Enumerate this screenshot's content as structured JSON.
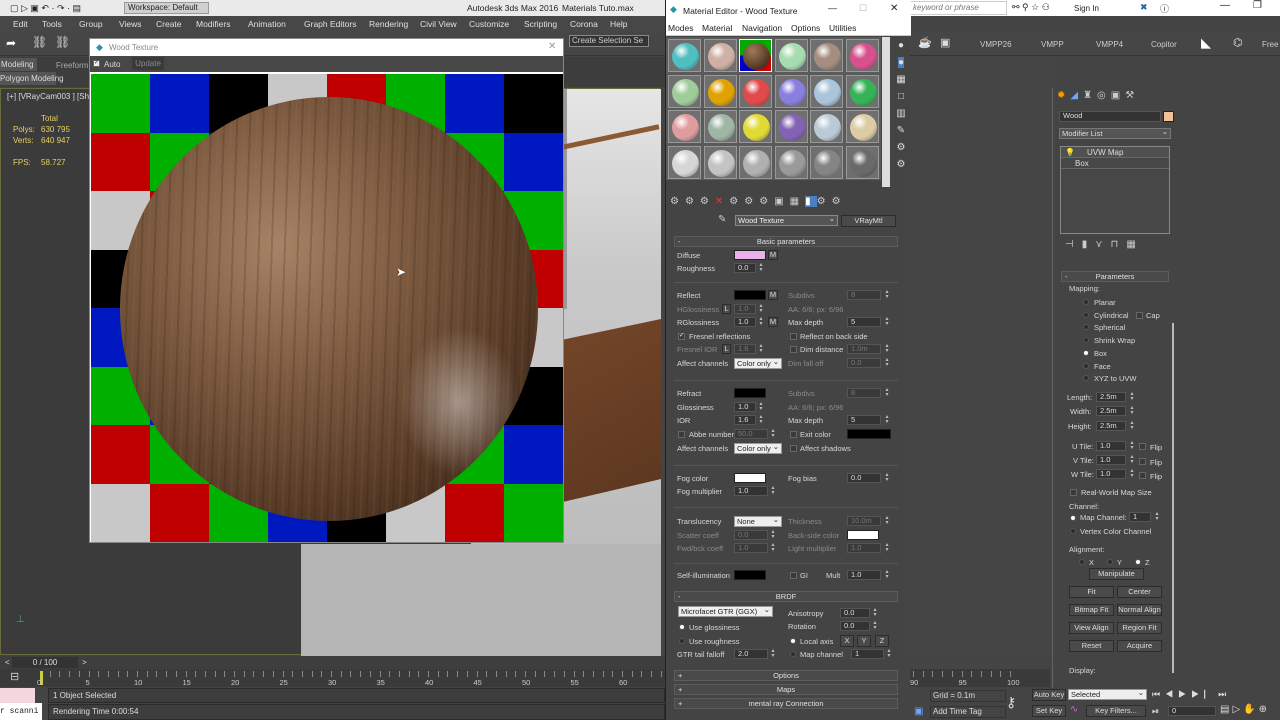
{
  "app": {
    "title": "Autodesk 3ds Max 2016",
    "file": "Materials Tuto.max",
    "workspace": "Workspace: Default",
    "search_placeholder": "keyword or phrase",
    "sign_in": "Sign In"
  },
  "menu": [
    "Edit",
    "Tools",
    "Group",
    "Views",
    "Create",
    "Modifiers",
    "Animation",
    "Graph Editors",
    "Rendering",
    "Civil View",
    "Customize",
    "Scripting",
    "Corona",
    "Help"
  ],
  "toolbar": {
    "selection_set": "Create Selection Se",
    "custom_buttons": [
      "VMPP26",
      "VMPP",
      "VMPP4",
      "Copitor"
    ],
    "free": "Free"
  },
  "ribbon": {
    "tabs": [
      "Modeling",
      "Freeform"
    ],
    "subtab": "Polygon Modeling"
  },
  "viewport": {
    "label": "[+] [VRayCam003 ] [Sh",
    "total": "Total",
    "polys_label": "Polys:",
    "polys": "630 795",
    "verts_label": "Verts:",
    "verts": "640 947",
    "fps_label": "FPS:",
    "fps": "58.727"
  },
  "render_window": {
    "title": "Wood Texture",
    "auto": "Auto",
    "update": "Update"
  },
  "mat_editor": {
    "title": "Material Editor - Wood Texture",
    "menu": [
      "Modes",
      "Material",
      "Navigation",
      "Options",
      "Utilities"
    ],
    "slot_colors": [
      "#4fbfc0",
      "#cfb0a4",
      "wood",
      "#a6dcb0",
      "#a58e80",
      "#d8508e",
      "#a0cc9c",
      "#e0a200",
      "#e04a4a",
      "#8a7ede",
      "#aac4dc",
      "#35b356",
      "#e09da0",
      "#9fb6a6",
      "#e2da34",
      "#8462b4",
      "#bccad8",
      "#dccca4",
      "#d6d6d6",
      "#c4c4c4",
      "#b0b0b0",
      "#9a9a9a",
      "#858585",
      "#6a6a6a"
    ],
    "material_name": "Wood Texture",
    "material_type": "VRayMtl",
    "basic": {
      "title": "Basic parameters",
      "minus": "-",
      "diffuse": "Diffuse",
      "diffuse_color": "#e8b2e8",
      "m": "M",
      "roughness": "Roughness",
      "roughness_val": "0.0",
      "reflect": "Reflect",
      "subdivs": "Subdivs",
      "subdivs_val": "8",
      "hgloss": "HGlossiness",
      "l": "L",
      "hgloss_val": "1.0",
      "aa": "AA: 6/6; px: 6/96",
      "rgloss": "RGlossiness",
      "rgloss_val": "1.0",
      "max_depth": "Max depth",
      "max_depth_val": "5",
      "fresnel": "Fresnel reflections",
      "back_side": "Reflect on back side",
      "fresnel_ior": "Fresnel IOR",
      "fresnel_ior_val": "1.6",
      "dim_distance": "Dim distance",
      "dim_distance_val": "1.0m",
      "affect": "Affect channels",
      "affect_val": "Color only",
      "dim_falloff": "Dim fall off",
      "dim_falloff_val": "0.0",
      "refract": "Refract",
      "r_subdivs_val": "8",
      "glossiness": "Glossiness",
      "glossiness_val": "1.0",
      "r_aa": "AA: 6/6; px: 6/96",
      "ior": "IOR",
      "ior_val": "1.6",
      "r_max_depth_val": "5",
      "abbe": "Abbe number",
      "abbe_val": "50.0",
      "exit_color": "Exit color",
      "r_affect_val": "Color only",
      "affect_shadows": "Affect shadows",
      "fog_color": "Fog color",
      "fog_bias": "Fog bias",
      "fog_bias_val": "0.0",
      "fog_mult": "Fog multiplier",
      "fog_mult_val": "1.0",
      "translucency": "Translucency",
      "translucency_val": "None",
      "thickness": "Thickness",
      "thickness_val": "10.0m",
      "scatter": "Scatter coeff",
      "scatter_val": "0.0",
      "backside_color": "Back-side color",
      "fwd": "Fwd/bck coeff",
      "fwd_val": "1.0",
      "light_mult": "Light multiplier",
      "light_mult_val": "1.0",
      "self_illum": "Self-illumination",
      "gi": "GI",
      "mult": "Mult",
      "mult_val": "1.0"
    },
    "brdf": {
      "title": "BRDF",
      "type": "Microfacet GTR (GGX)",
      "anisotropy": "Anisotropy",
      "anisotropy_val": "0.0",
      "rotation": "Rotation",
      "rotation_val": "0.0",
      "use_gloss": "Use glossiness",
      "use_rough": "Use roughness",
      "local_axis": "Local axis",
      "x": "X",
      "y": "Y",
      "z": "Z",
      "gtr": "GTR tail falloff",
      "gtr_val": "2.0",
      "map_channel": "Map channel",
      "map_channel_val": "1"
    },
    "rollouts": [
      "Options",
      "Maps",
      "mental ray Connection"
    ],
    "plus": "+"
  },
  "command_panel": {
    "object_name": "Wood",
    "object_color": "#f0c298",
    "modifier_list": "Modifier List",
    "stack": [
      "UVW Map",
      "Box"
    ],
    "params_title": "Parameters",
    "minus": "-",
    "mapping_label": "Mapping:",
    "mapping_options": [
      "Planar",
      "Cylindrical",
      "Spherical",
      "Shrink Wrap",
      "Box",
      "Face",
      "XYZ to UVW"
    ],
    "mapping_selected": "Box",
    "cap": "Cap",
    "length": "Length:",
    "length_val": "2.5m",
    "width": "Width:",
    "width_val": "2.5m",
    "height": "Height:",
    "height_val": "2.5m",
    "u_tile": "U Tile:",
    "v_tile": "V Tile:",
    "w_tile": "W Tile:",
    "u_val": "1.0",
    "v_val": "1.0",
    "w_val": "1.0",
    "flip": "Flip",
    "real_world": "Real-World Map Size",
    "channel_label": "Channel:",
    "map_channel": "Map Channel:",
    "map_channel_val": "1",
    "vertex_color": "Vertex Color Channel",
    "alignment_label": "Alignment:",
    "axes": [
      "X",
      "Y",
      "Z"
    ],
    "axis_selected": "Z",
    "manipulate": "Manipulate",
    "buttons": [
      "Fit",
      "Center",
      "Bitmap Fit",
      "Normal Align",
      "View Align",
      "Region Fit",
      "Reset",
      "Acquire"
    ],
    "display_label": "Display:"
  },
  "timeline": {
    "frame": "0 / 100",
    "prev": "<",
    "next": ">",
    "ticks": [
      0,
      5,
      10,
      15,
      20,
      25,
      30,
      35,
      40,
      45,
      50,
      55,
      60,
      90,
      95,
      100
    ],
    "status": "1 Object Selected",
    "rendering_time": "Rendering Time  0:00:54",
    "script": "r scanni",
    "grid": "Grid = 0.1m",
    "add_time_tag": "Add Time Tag",
    "auto_key": "Auto Key",
    "set_key": "Set Key",
    "selected": "Selected",
    "key_filters": "Key Filters...",
    "frame_value": "0"
  }
}
